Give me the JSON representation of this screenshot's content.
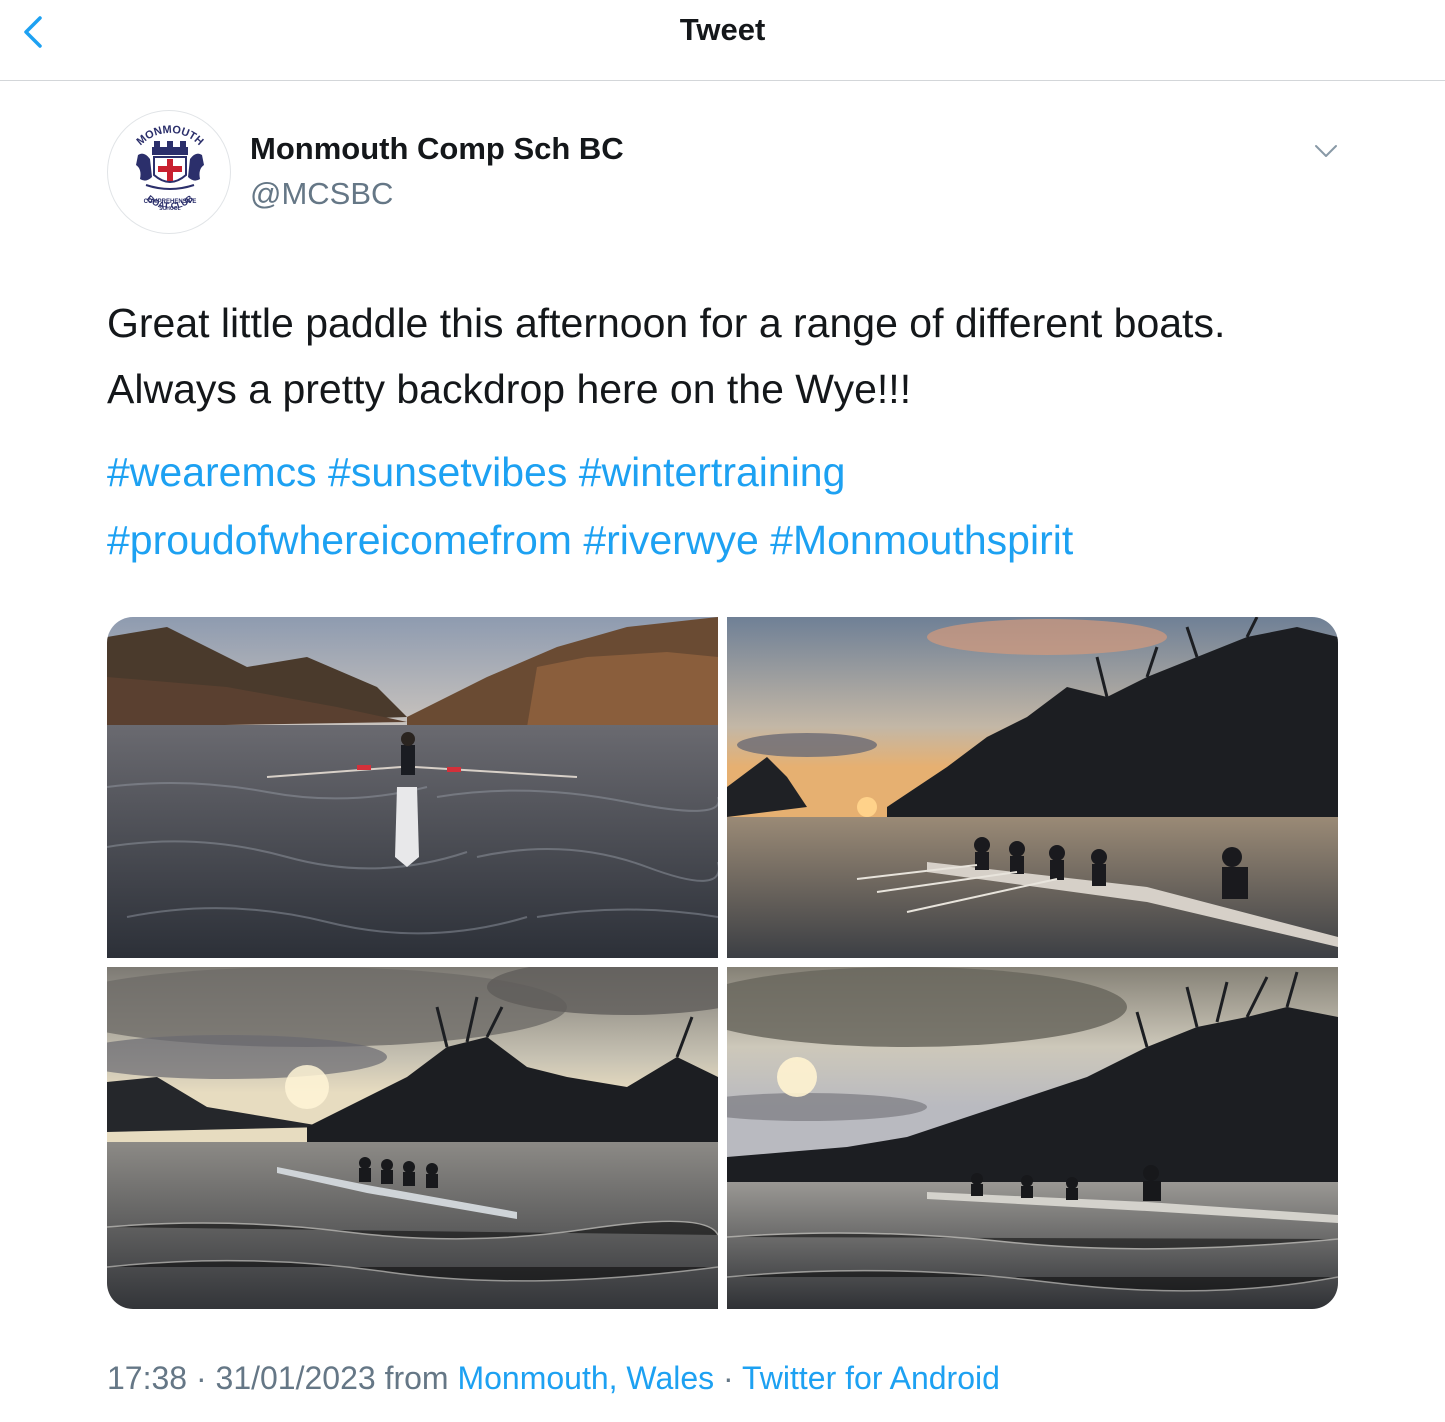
{
  "header": {
    "title": "Tweet",
    "back_icon": "chevron-left-icon"
  },
  "author": {
    "name": "Monmouth Comp Sch BC",
    "handle": "@MCSBC",
    "avatar_text_top": "MONMOUTH",
    "avatar_text_mid_1": "COMPREHENSIVE",
    "avatar_text_mid_2": "SCHOOL",
    "avatar_text_bottom": "BOAT CLUB",
    "menu_icon": "chevron-down-icon"
  },
  "tweet": {
    "line1": "Great little paddle this afternoon for a range of different boats.",
    "line2": "Always a pretty backdrop here on the Wye!!!",
    "hashtags_line1": [
      "#wearemcs",
      "#sunsetvibes",
      "#wintertraining"
    ],
    "hashtags_line2": [
      "#proudofwhereicomefrom",
      "#riverwye",
      "#Monmouthspirit"
    ]
  },
  "media": {
    "photos": [
      {
        "description": "single sculler on river between wooded banks"
      },
      {
        "description": "quad boat on river at sunset with silhouetted trees"
      },
      {
        "description": "crew rowing on river under cloudy sunset sky"
      },
      {
        "description": "crew rowing past silhouetted trees at sunset"
      }
    ]
  },
  "meta": {
    "time": "17:38",
    "separator": "·",
    "date": "31/01/2023",
    "from": "from",
    "location": "Monmouth, Wales",
    "source": "Twitter for Android"
  },
  "colors": {
    "link": "#1da1f2",
    "secondary": "#657786",
    "text": "#14171a"
  }
}
